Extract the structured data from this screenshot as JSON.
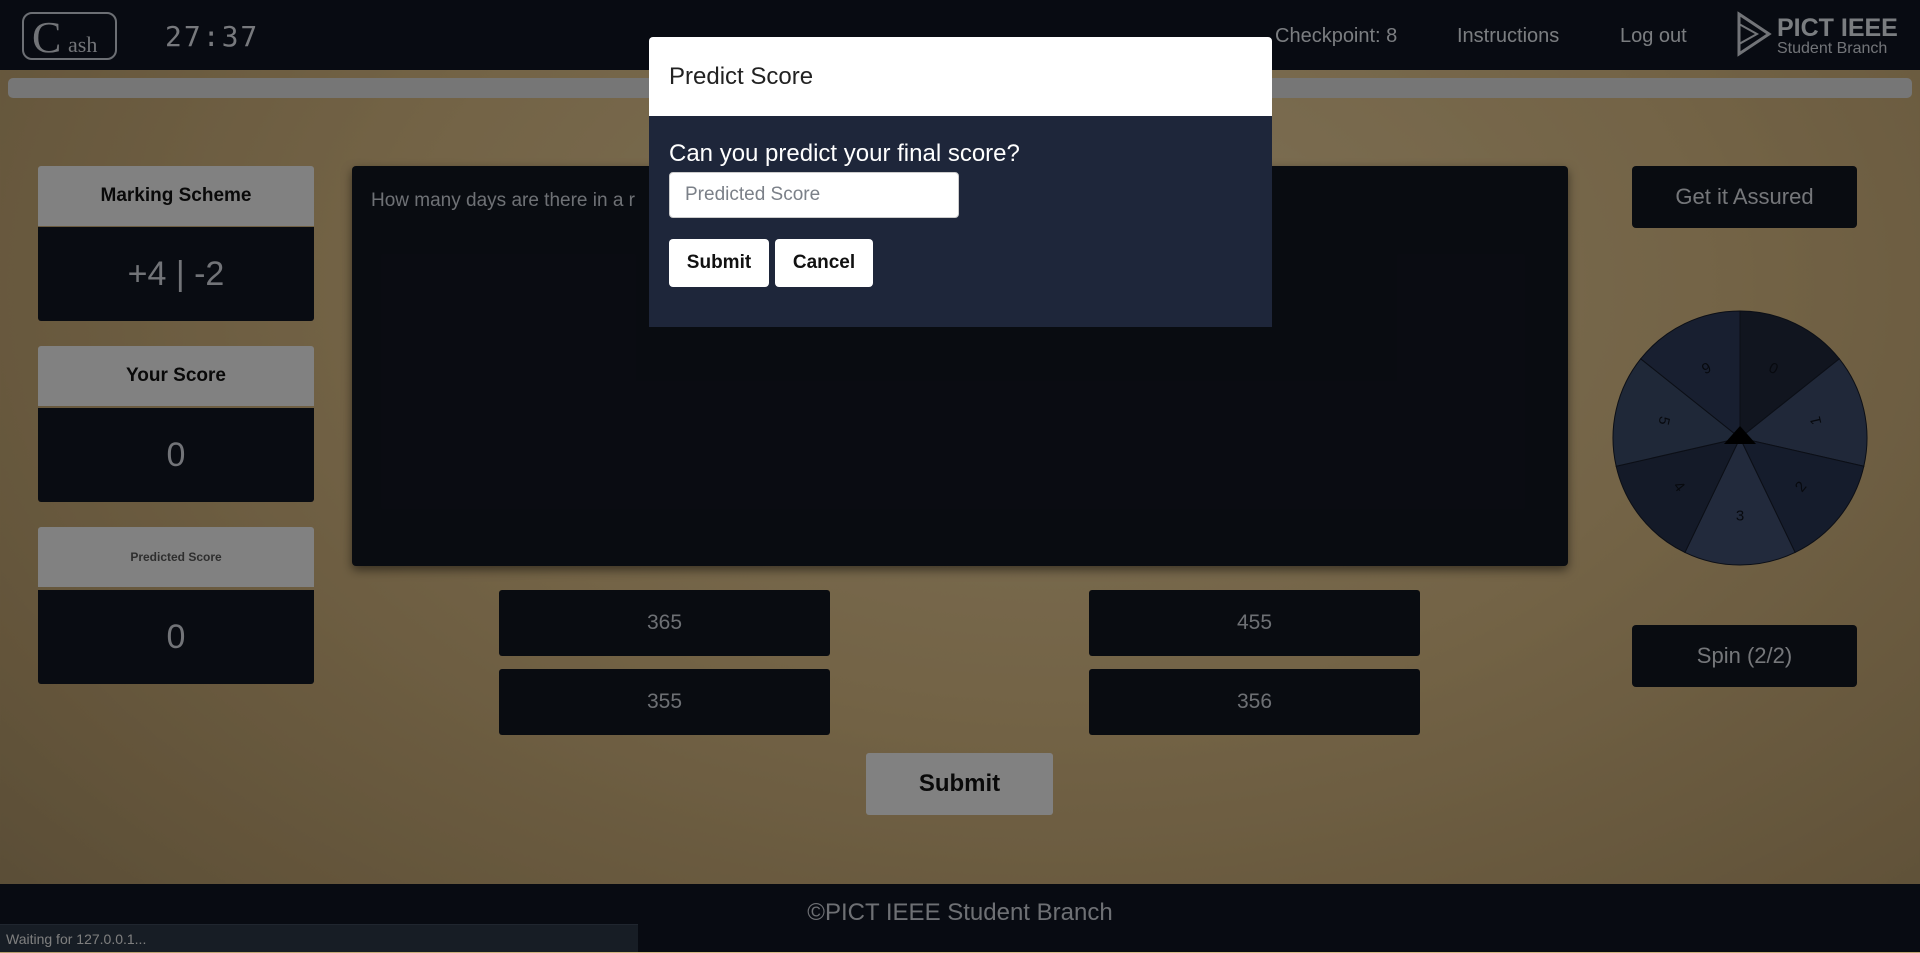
{
  "nav": {
    "logo_big": "C",
    "logo_small": "ash",
    "timer": "27:37",
    "checkpoint": "Checkpoint: 8",
    "instructions": "Instructions",
    "logout": "Log out",
    "brand_line1": "PICT IEEE",
    "brand_line2": "Student Branch"
  },
  "progress": {
    "fraction": 0.0
  },
  "cards": {
    "marking_title": "Marking Scheme",
    "marking_value": "+4 | -2",
    "score_title": "Your Score",
    "score_value": "0",
    "predicted_title": "Predicted Score",
    "predicted_value": "0"
  },
  "question": {
    "text": "How many days are there in a r"
  },
  "options": [
    "365",
    "455",
    "355",
    "356"
  ],
  "submit_label": "Submit",
  "side": {
    "assure_label": "Get it Assured",
    "spin_label": "Spin (2/2)"
  },
  "wheel": {
    "segments": [
      "0",
      "1",
      "2",
      "3",
      "4",
      "5",
      "6"
    ],
    "colors": [
      "#1f273a",
      "#3b4a68",
      "#273350",
      "#3e4d6d",
      "#263149",
      "#3a4966",
      "#2d3a58"
    ]
  },
  "footer": "©PICT IEEE Student Branch",
  "status": "Waiting for 127.0.0.1...",
  "modal": {
    "title": "Predict Score",
    "question": "Can you predict your final score?",
    "placeholder": "Predicted Score",
    "submit": "Submit",
    "cancel": "Cancel"
  }
}
